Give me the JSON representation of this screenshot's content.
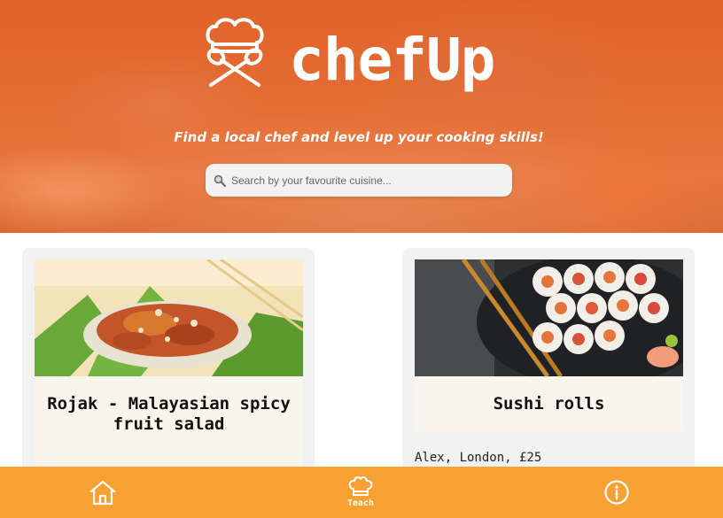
{
  "header": {
    "brand": "chefUp",
    "tagline": "Find a local chef and level up your cooking skills!",
    "logo_icon": "chef-hat-utensils-icon"
  },
  "search": {
    "placeholder": "Search by your favourite cuisine...",
    "value": "",
    "icon": "search-icon"
  },
  "cards": [
    {
      "title": "Rojak - Malayasian spicy fruit salad",
      "image": "rojak-salad-photo",
      "meta": ""
    },
    {
      "title": "Sushi rolls",
      "image": "sushi-rolls-photo",
      "meta": "Alex, London, £25"
    }
  ],
  "nav": {
    "items": [
      {
        "icon": "home-icon",
        "label": ""
      },
      {
        "icon": "chef-hat-icon",
        "label": "Teach"
      },
      {
        "icon": "info-icon",
        "label": ""
      }
    ]
  },
  "colors": {
    "hero": "#e46d35",
    "nav_bar": "#f8a133",
    "card_bg": "#f2f2f2",
    "title_box": "#faf5ec"
  }
}
